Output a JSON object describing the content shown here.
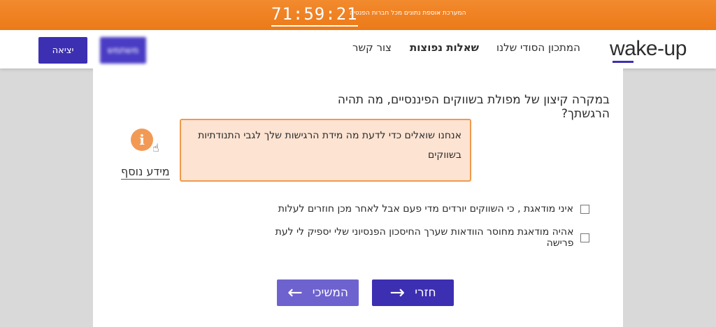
{
  "topbar": {
    "timer": "71:59:21",
    "notice": "המערכת אוספת נתונים מכל חברות הפנסיה"
  },
  "header": {
    "logo": "wake-up",
    "nav": [
      {
        "label": "המתכון הסודי שלנו"
      },
      {
        "label": "שאלות נפוצות"
      },
      {
        "label": "צור קשר"
      }
    ],
    "user_button": "משתמש",
    "logout_button": "יציאה"
  },
  "question": "במקרה קיצון של מפולת בשווקים הפיננסיים, מה תהיה הרגשתך?",
  "info": {
    "icon": "info-icon",
    "link_label": "מידע נוסף",
    "tooltip": "אנחנו שואלים כדי לדעת מה מידת הרגישות שלך לגבי התנודתיות בשווקים"
  },
  "options": [
    {
      "label": "איני מודאגת , כי השווקים יורדים מדי פעם אבל לאחר מכן חוזרים לעלות",
      "checked": false
    },
    {
      "label": "אהיה מודאגת מחוסר הוודאות שערך החיסכון הפנסיוני שלי יספיק לי לעת פרישה",
      "checked": false
    }
  ],
  "buttons": {
    "next": "חזרי",
    "prev": "המשיכי"
  },
  "colors": {
    "accent": "#3d2fb2",
    "topbar": "#ee7d1e",
    "tooltip_bg": "#fde3d2",
    "tooltip_border": "#ef9a4d"
  }
}
